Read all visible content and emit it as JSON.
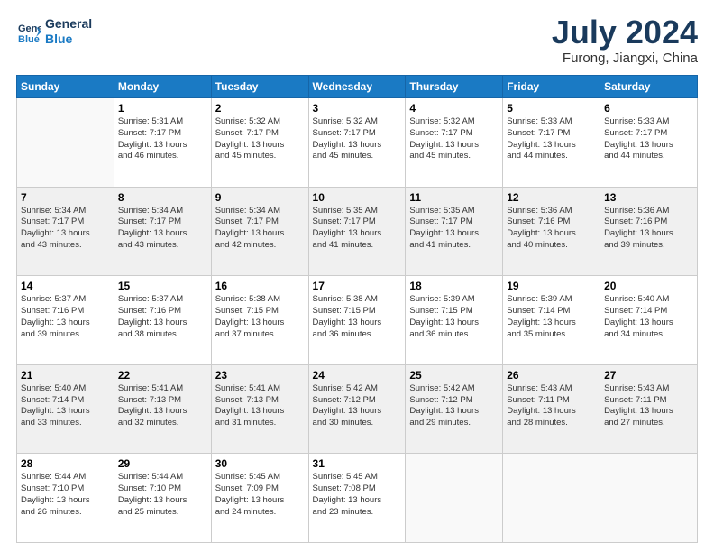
{
  "header": {
    "logo_line1": "General",
    "logo_line2": "Blue",
    "title": "July 2024",
    "location": "Furong, Jiangxi, China"
  },
  "weekdays": [
    "Sunday",
    "Monday",
    "Tuesday",
    "Wednesday",
    "Thursday",
    "Friday",
    "Saturday"
  ],
  "weeks": [
    [
      {
        "day": "",
        "info": ""
      },
      {
        "day": "1",
        "info": "Sunrise: 5:31 AM\nSunset: 7:17 PM\nDaylight: 13 hours\nand 46 minutes."
      },
      {
        "day": "2",
        "info": "Sunrise: 5:32 AM\nSunset: 7:17 PM\nDaylight: 13 hours\nand 45 minutes."
      },
      {
        "day": "3",
        "info": "Sunrise: 5:32 AM\nSunset: 7:17 PM\nDaylight: 13 hours\nand 45 minutes."
      },
      {
        "day": "4",
        "info": "Sunrise: 5:32 AM\nSunset: 7:17 PM\nDaylight: 13 hours\nand 45 minutes."
      },
      {
        "day": "5",
        "info": "Sunrise: 5:33 AM\nSunset: 7:17 PM\nDaylight: 13 hours\nand 44 minutes."
      },
      {
        "day": "6",
        "info": "Sunrise: 5:33 AM\nSunset: 7:17 PM\nDaylight: 13 hours\nand 44 minutes."
      }
    ],
    [
      {
        "day": "7",
        "info": "Sunrise: 5:34 AM\nSunset: 7:17 PM\nDaylight: 13 hours\nand 43 minutes."
      },
      {
        "day": "8",
        "info": "Sunrise: 5:34 AM\nSunset: 7:17 PM\nDaylight: 13 hours\nand 43 minutes."
      },
      {
        "day": "9",
        "info": "Sunrise: 5:34 AM\nSunset: 7:17 PM\nDaylight: 13 hours\nand 42 minutes."
      },
      {
        "day": "10",
        "info": "Sunrise: 5:35 AM\nSunset: 7:17 PM\nDaylight: 13 hours\nand 41 minutes."
      },
      {
        "day": "11",
        "info": "Sunrise: 5:35 AM\nSunset: 7:17 PM\nDaylight: 13 hours\nand 41 minutes."
      },
      {
        "day": "12",
        "info": "Sunrise: 5:36 AM\nSunset: 7:16 PM\nDaylight: 13 hours\nand 40 minutes."
      },
      {
        "day": "13",
        "info": "Sunrise: 5:36 AM\nSunset: 7:16 PM\nDaylight: 13 hours\nand 39 minutes."
      }
    ],
    [
      {
        "day": "14",
        "info": "Sunrise: 5:37 AM\nSunset: 7:16 PM\nDaylight: 13 hours\nand 39 minutes."
      },
      {
        "day": "15",
        "info": "Sunrise: 5:37 AM\nSunset: 7:16 PM\nDaylight: 13 hours\nand 38 minutes."
      },
      {
        "day": "16",
        "info": "Sunrise: 5:38 AM\nSunset: 7:15 PM\nDaylight: 13 hours\nand 37 minutes."
      },
      {
        "day": "17",
        "info": "Sunrise: 5:38 AM\nSunset: 7:15 PM\nDaylight: 13 hours\nand 36 minutes."
      },
      {
        "day": "18",
        "info": "Sunrise: 5:39 AM\nSunset: 7:15 PM\nDaylight: 13 hours\nand 36 minutes."
      },
      {
        "day": "19",
        "info": "Sunrise: 5:39 AM\nSunset: 7:14 PM\nDaylight: 13 hours\nand 35 minutes."
      },
      {
        "day": "20",
        "info": "Sunrise: 5:40 AM\nSunset: 7:14 PM\nDaylight: 13 hours\nand 34 minutes."
      }
    ],
    [
      {
        "day": "21",
        "info": "Sunrise: 5:40 AM\nSunset: 7:14 PM\nDaylight: 13 hours\nand 33 minutes."
      },
      {
        "day": "22",
        "info": "Sunrise: 5:41 AM\nSunset: 7:13 PM\nDaylight: 13 hours\nand 32 minutes."
      },
      {
        "day": "23",
        "info": "Sunrise: 5:41 AM\nSunset: 7:13 PM\nDaylight: 13 hours\nand 31 minutes."
      },
      {
        "day": "24",
        "info": "Sunrise: 5:42 AM\nSunset: 7:12 PM\nDaylight: 13 hours\nand 30 minutes."
      },
      {
        "day": "25",
        "info": "Sunrise: 5:42 AM\nSunset: 7:12 PM\nDaylight: 13 hours\nand 29 minutes."
      },
      {
        "day": "26",
        "info": "Sunrise: 5:43 AM\nSunset: 7:11 PM\nDaylight: 13 hours\nand 28 minutes."
      },
      {
        "day": "27",
        "info": "Sunrise: 5:43 AM\nSunset: 7:11 PM\nDaylight: 13 hours\nand 27 minutes."
      }
    ],
    [
      {
        "day": "28",
        "info": "Sunrise: 5:44 AM\nSunset: 7:10 PM\nDaylight: 13 hours\nand 26 minutes."
      },
      {
        "day": "29",
        "info": "Sunrise: 5:44 AM\nSunset: 7:10 PM\nDaylight: 13 hours\nand 25 minutes."
      },
      {
        "day": "30",
        "info": "Sunrise: 5:45 AM\nSunset: 7:09 PM\nDaylight: 13 hours\nand 24 minutes."
      },
      {
        "day": "31",
        "info": "Sunrise: 5:45 AM\nSunset: 7:08 PM\nDaylight: 13 hours\nand 23 minutes."
      },
      {
        "day": "",
        "info": ""
      },
      {
        "day": "",
        "info": ""
      },
      {
        "day": "",
        "info": ""
      }
    ]
  ]
}
